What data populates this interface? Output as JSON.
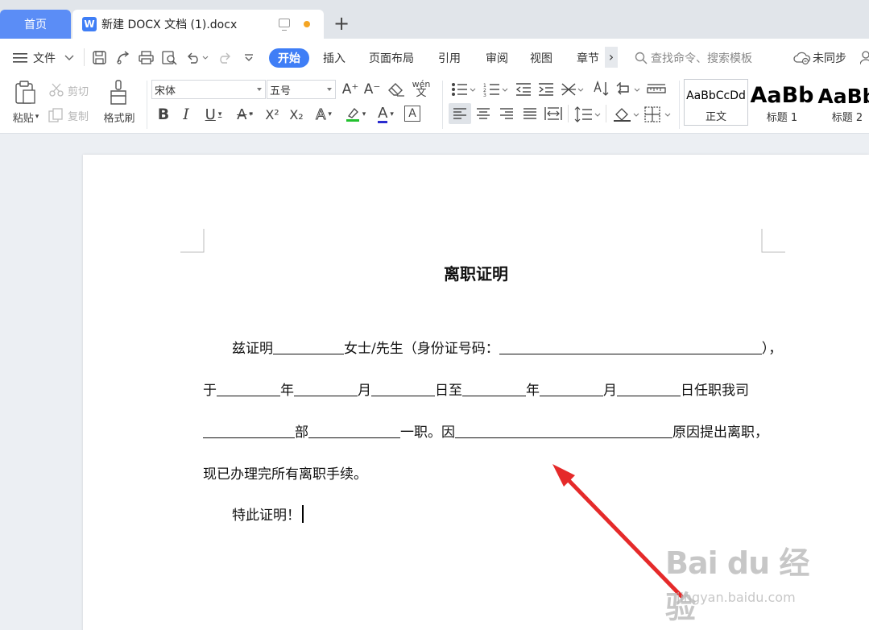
{
  "tabs": {
    "home": "首页",
    "doc_icon": "W",
    "doc_title": "新建 DOCX 文档 (1).docx",
    "new_tab": "+"
  },
  "menu": {
    "file": "文件",
    "start": "开始",
    "insert": "插入",
    "layout": "页面布局",
    "references": "引用",
    "review": "审阅",
    "view": "视图",
    "chapter": "章节",
    "more": "›",
    "search_placeholder": "查找命令、搜索模板",
    "sync": "未同步"
  },
  "ribbon": {
    "paste": "粘贴",
    "cut": "剪切",
    "copy": "复制",
    "format_painter": "格式刷",
    "font_name": "宋体",
    "font_size": "五号",
    "bold": "B",
    "italic": "I",
    "underline": "U",
    "strike": "A",
    "superscript": "X²",
    "subscript": "X₂",
    "text_effect": "A",
    "font_color": "A",
    "char_border": "A",
    "grow": "A⁺",
    "shrink": "A⁻",
    "phonetic": "wén",
    "styles": [
      {
        "preview": "AaBbCcDd",
        "name": "正文"
      },
      {
        "preview": "AaBb",
        "name": "标题 1"
      },
      {
        "preview": "AaBb",
        "name": "标题 2"
      }
    ],
    "colors": {
      "highlight": "#22c12e",
      "font": "#2b2ccf",
      "accent": "#3f7ef6"
    }
  },
  "document": {
    "title": "离职证明",
    "line1": {
      "a": "兹证明",
      "b": "女士/先生（身份证号码：",
      "c": "），"
    },
    "line2": {
      "a": "于",
      "y1": "年",
      "m1": "月",
      "d1": "日至",
      "y2": "年",
      "m2": "月",
      "d2": "日任职我司"
    },
    "line3": {
      "a": "部",
      "b": "一职。因",
      "c": "原因提出离职，"
    },
    "line4": "现已办理完所有离职手续。",
    "line5": "特此证明！"
  },
  "watermark": {
    "logo": "Bai du 经验",
    "url": "jingyan.baidu.com"
  }
}
